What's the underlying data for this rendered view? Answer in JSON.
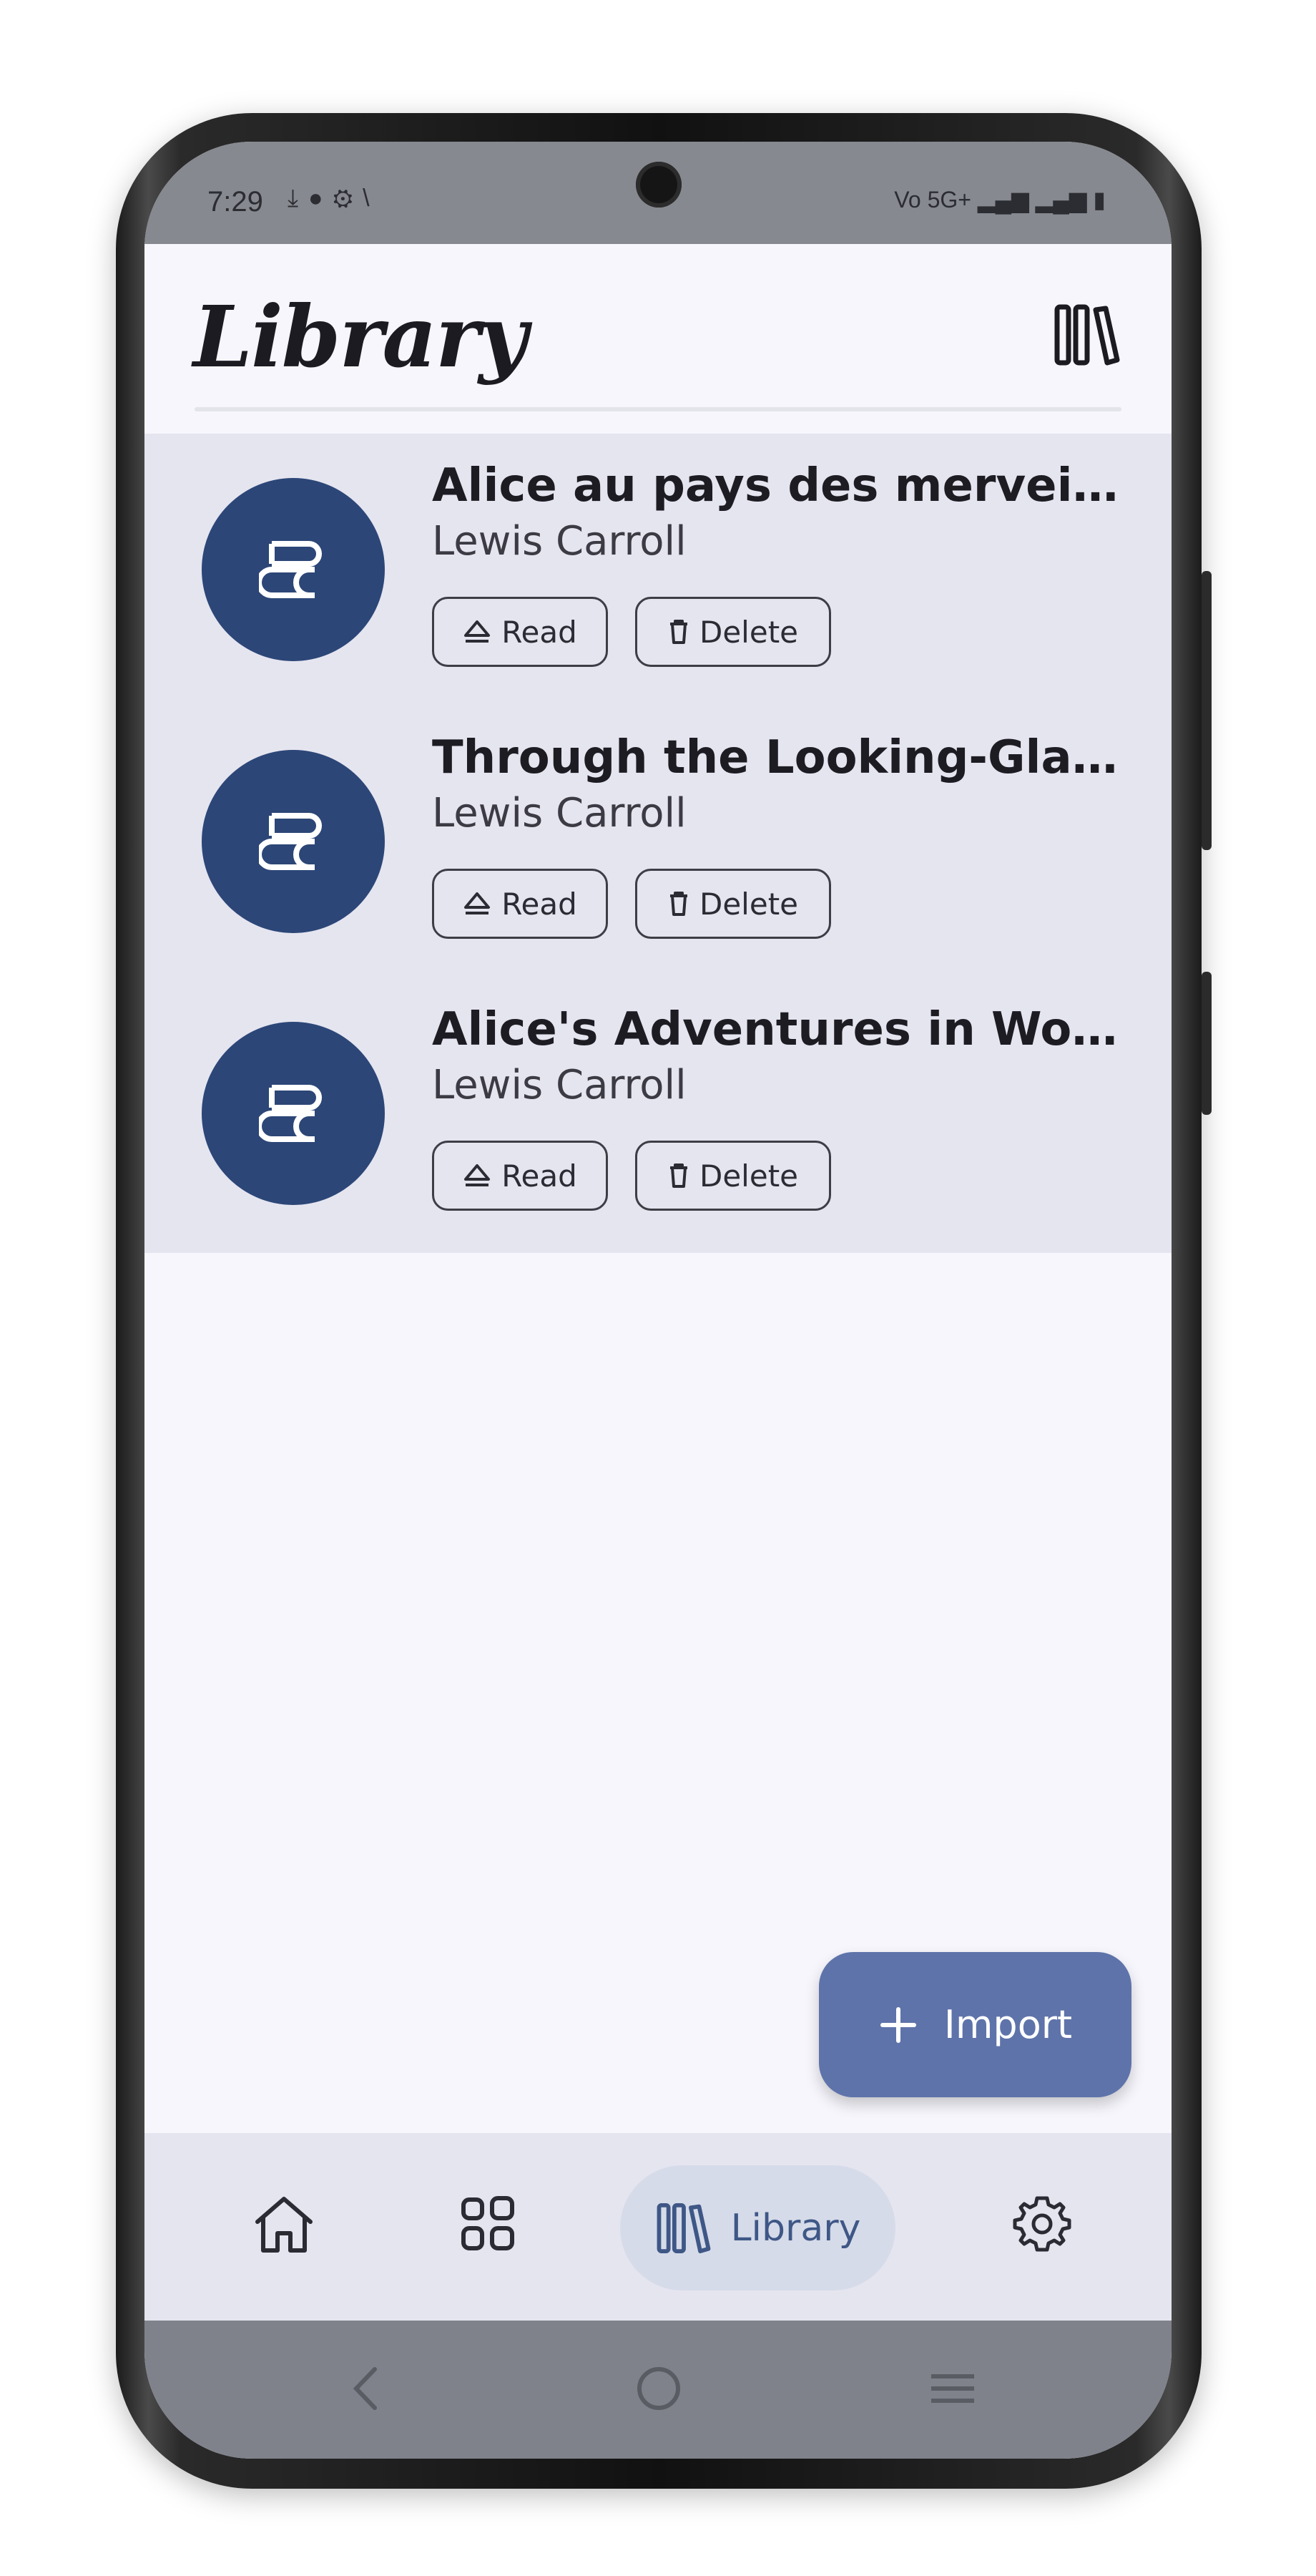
{
  "status_bar": {
    "time": "7:29",
    "left_icons": [
      "download-icon",
      "message-icon",
      "settings-icon",
      "signal-slash-icon"
    ],
    "right_text": "Vo 5G+",
    "right_icons": [
      "signal-icon",
      "signal-icon",
      "battery-icon"
    ]
  },
  "header": {
    "title": "Library",
    "icon": "library-books-icon"
  },
  "books": [
    {
      "title": "Alice au pays des merveill…",
      "author": "Lewis Carroll",
      "read_label": "Read",
      "delete_label": "Delete"
    },
    {
      "title": "Through the Looking-Glas…",
      "author": "Lewis Carroll",
      "read_label": "Read",
      "delete_label": "Delete"
    },
    {
      "title": "Alice's Adventures in Won…",
      "author": "Lewis Carroll",
      "read_label": "Read",
      "delete_label": "Delete"
    }
  ],
  "fab": {
    "label": "Import",
    "icon": "plus-icon"
  },
  "bottom_nav": {
    "items": [
      {
        "name": "home",
        "icon": "home-icon"
      },
      {
        "name": "apps",
        "icon": "grid-icon"
      },
      {
        "name": "library",
        "icon": "library-books-icon",
        "label": "Library",
        "active": true
      },
      {
        "name": "settings",
        "icon": "gear-icon"
      }
    ]
  },
  "system_nav": {
    "icons": [
      "back-icon",
      "home-circle-icon",
      "recents-icon"
    ]
  },
  "colors": {
    "accent": "#5e73aa",
    "avatar": "#2c4677",
    "list_bg": "#e5e5f0",
    "app_bg": "#f6f6fc",
    "active_nav": "#d6dbe9"
  }
}
